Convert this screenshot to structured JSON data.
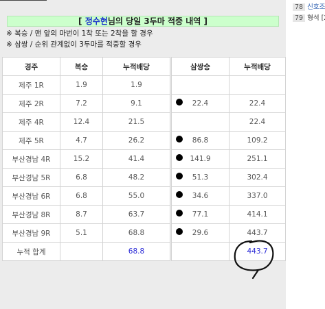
{
  "title": {
    "open_bracket": "[",
    "name": "정수현",
    "rest": "님의 당일 3두마 적중 내역",
    "close_bracket": "]"
  },
  "notes": [
    "※ 복승 / 맨 앞의 마번이 1착 또는 2착을 할 경우",
    "※ 삼쌍 / 순위 관계없이 3두마를 적중할 경우"
  ],
  "left_table": {
    "headers": [
      "경주",
      "복승",
      "누적배당"
    ],
    "rows": [
      {
        "race": "제주 1R",
        "bokseung": "1.9",
        "cumulative": "1.9"
      },
      {
        "race": "제주 2R",
        "bokseung": "7.2",
        "cumulative": "9.1"
      },
      {
        "race": "제주 4R",
        "bokseung": "12.4",
        "cumulative": "21.5"
      },
      {
        "race": "제주 5R",
        "bokseung": "4.7",
        "cumulative": "26.2"
      },
      {
        "race": "부산경남 4R",
        "bokseung": "15.2",
        "cumulative": "41.4"
      },
      {
        "race": "부산경남 5R",
        "bokseung": "6.8",
        "cumulative": "48.2"
      },
      {
        "race": "부산경남 6R",
        "bokseung": "6.8",
        "cumulative": "55.0"
      },
      {
        "race": "부산경남 8R",
        "bokseung": "8.7",
        "cumulative": "63.7"
      },
      {
        "race": "부산경남 9R",
        "bokseung": "5.1",
        "cumulative": "68.8"
      }
    ],
    "total": {
      "label": "누적 합계",
      "value": "68.8"
    }
  },
  "right_table": {
    "headers": [
      "삼쌍승",
      "누적배당"
    ],
    "rows": [
      {
        "samssang": "",
        "cumulative": "",
        "marked": false
      },
      {
        "samssang": "22.4",
        "cumulative": "22.4",
        "marked": true
      },
      {
        "samssang": "",
        "cumulative": "22.4",
        "marked": false
      },
      {
        "samssang": "86.8",
        "cumulative": "109.2",
        "marked": true
      },
      {
        "samssang": "141.9",
        "cumulative": "251.1",
        "marked": true
      },
      {
        "samssang": "51.3",
        "cumulative": "302.4",
        "marked": true
      },
      {
        "samssang": "34.6",
        "cumulative": "337.0",
        "marked": true
      },
      {
        "samssang": "77.1",
        "cumulative": "414.1",
        "marked": true
      },
      {
        "samssang": "29.6",
        "cumulative": "443.7",
        "marked": true
      }
    ],
    "total": {
      "value": "443.7"
    }
  },
  "sidebar": {
    "items": [
      {
        "num": "78",
        "text": "신호조"
      },
      {
        "num": "79",
        "text": "형석 [2"
      }
    ]
  },
  "colors": {
    "title_bg": "#ccffcc",
    "name": "#1a33cc",
    "total_blue": "#2a2ad6",
    "panel_bg": "#ececec"
  }
}
